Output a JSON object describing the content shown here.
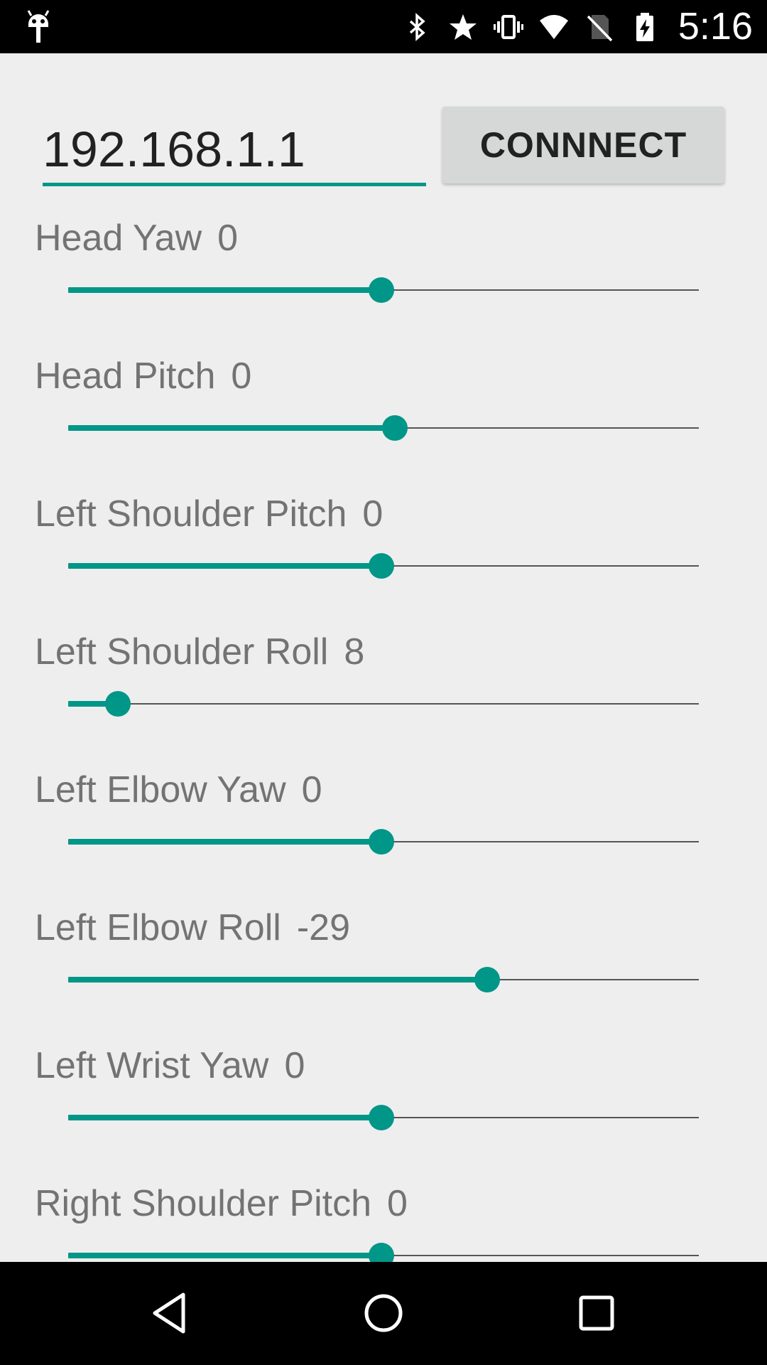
{
  "status_bar": {
    "time": "5:16",
    "icons": [
      "android-debug-icon",
      "bluetooth-icon",
      "star-icon",
      "vibrate-icon",
      "wifi-icon",
      "no-sim-icon",
      "battery-charging-icon"
    ]
  },
  "connection": {
    "ip_value": "192.168.1.1",
    "connect_label": "CONNNECT"
  },
  "joints": [
    {
      "label": "Head Yaw",
      "value": "0",
      "fraction": 0.497
    },
    {
      "label": "Head Pitch",
      "value": "0",
      "fraction": 0.518
    },
    {
      "label": "Left Shoulder Pitch",
      "value": "0",
      "fraction": 0.497
    },
    {
      "label": "Left Shoulder Roll",
      "value": "8",
      "fraction": 0.079
    },
    {
      "label": "Left Elbow Yaw",
      "value": "0",
      "fraction": 0.497
    },
    {
      "label": "Left Elbow Roll",
      "value": "-29",
      "fraction": 0.664
    },
    {
      "label": "Left Wrist Yaw",
      "value": "0",
      "fraction": 0.497
    },
    {
      "label": "Right Shoulder Pitch",
      "value": "0",
      "fraction": 0.497
    }
  ],
  "nav_bar": {
    "buttons": [
      "back-icon",
      "home-icon",
      "recents-icon"
    ]
  },
  "colors": {
    "accent": "#009688",
    "background": "#EEEEEE",
    "label_text": "#737373",
    "button_bg": "#D6D7D7"
  }
}
